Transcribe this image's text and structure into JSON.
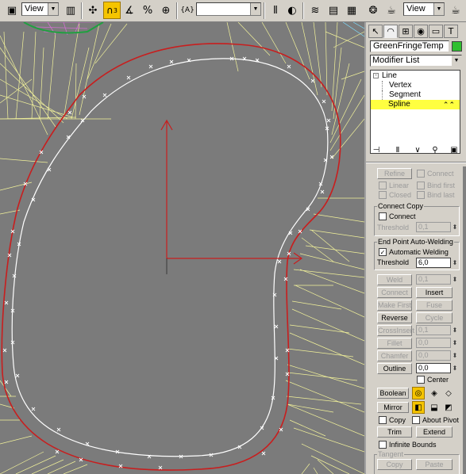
{
  "toolbar": {
    "view_left": "View",
    "view_right": "View",
    "selection_set": "",
    "snap_label": "3",
    "icons": [
      "select-icon",
      "cube-icon",
      "magnet-icon",
      "angle-snap-icon",
      "percent-snap-icon",
      "spinner-snap-icon",
      "named-sel-icon",
      "mirror-icon",
      "align-icon",
      "layers-icon",
      "curve-editor-icon",
      "schematic-icon",
      "material-icon",
      "render-scene-icon",
      "quick-render-icon"
    ]
  },
  "panel": {
    "object_name": "GreenFringeTemp",
    "object_color": "#2fbf2f",
    "modifier_list": "Modifier List",
    "stack": [
      {
        "label": "Line",
        "level": 0
      },
      {
        "label": "Vertex",
        "level": 1
      },
      {
        "label": "Segment",
        "level": 1
      },
      {
        "label": "Spline",
        "level": 1,
        "selected": true
      }
    ],
    "refine": "Refine",
    "connect": "Connect",
    "linear": "Linear",
    "bind_first": "Bind first",
    "closed": "Closed",
    "bind_last": "Bind last",
    "connect_copy_title": "Connect Copy",
    "connect_copy_check": "Connect",
    "threshold_label": "Threshold",
    "threshold_value": "0,1",
    "end_point_title": "End Point Auto-Welding",
    "auto_weld": "Automatic Welding",
    "auto_weld_threshold_label": "Threshold",
    "auto_weld_threshold": "6,0",
    "weld": "Weld",
    "weld_value": "0,1",
    "connect_btn": "Connect",
    "insert": "Insert",
    "make_first": "Make First",
    "fuse": "Fuse",
    "reverse": "Reverse",
    "cycle": "Cycle",
    "cross_insert": "CrossInsert",
    "cross_value": "0,1",
    "fillet": "Fillet",
    "fillet_value": "0,0",
    "chamfer": "Chamfer",
    "chamfer_value": "0,0",
    "outline": "Outline",
    "outline_value": "0,0",
    "center": "Center",
    "boolean": "Boolean",
    "mirror": "Mirror",
    "copy": "Copy",
    "about_pivot": "About Pivot",
    "trim": "Trim",
    "extend": "Extend",
    "infinite_bounds": "Infinite Bounds",
    "tangent_title": "Tangent",
    "copy2": "Copy",
    "paste": "Paste"
  },
  "colors": {
    "viewport_bg": "#7b7b7b",
    "mesh_lines": "#f2f29a",
    "red_spline": "#c81e1e",
    "white_spline": "#ffffff",
    "highlight": "#ffff40"
  }
}
